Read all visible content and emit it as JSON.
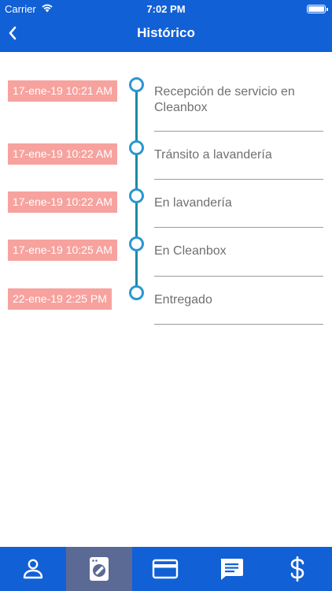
{
  "status_bar": {
    "carrier": "Carrier",
    "time": "7:02 PM"
  },
  "header": {
    "title": "Histórico",
    "back_icon": "chevron-left-icon"
  },
  "timeline": [
    {
      "date": "17-ene-19 10:21 AM",
      "status": "Recepción de servicio en Cleanbox"
    },
    {
      "date": "17-ene-19 10:22 AM",
      "status": "Tránsito a lavandería"
    },
    {
      "date": "17-ene-19 10:22 AM",
      "status": "En lavandería"
    },
    {
      "date": "17-ene-19 10:25 AM",
      "status": "En Cleanbox"
    },
    {
      "date": "22-ene-19 2:25 PM",
      "status": "Entregado"
    }
  ],
  "tab_bar": {
    "tabs": [
      {
        "icon": "user-icon",
        "active": false
      },
      {
        "icon": "washing-machine-icon",
        "active": true
      },
      {
        "icon": "credit-card-icon",
        "active": false
      },
      {
        "icon": "chat-icon",
        "active": false
      },
      {
        "icon": "dollar-icon",
        "active": false
      }
    ]
  },
  "colors": {
    "primary": "#1160d6",
    "active_tab": "#5b6a94",
    "date_badge": "#f7a29e",
    "timeline": "#2c97d0",
    "label_text": "#707070"
  }
}
